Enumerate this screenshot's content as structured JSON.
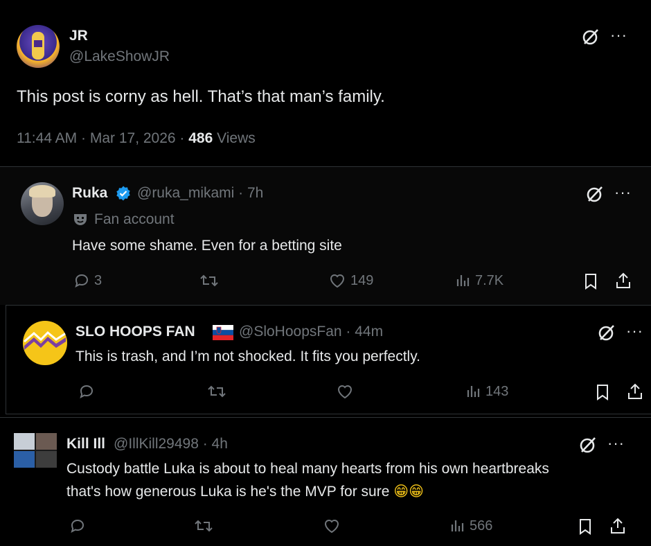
{
  "main_post": {
    "name": "JR",
    "handle": "@LakeShowJR",
    "text": "This post is corny as hell. That’s that man’s family.",
    "time": "11:44 AM · Mar 17, 2026 ·",
    "views_count": "486",
    "views_label": "Views"
  },
  "replies": [
    {
      "name": "Ruka",
      "verified": true,
      "handle_time": "@ruka_mikami · 7h",
      "badge_icon": "mask-icon",
      "badge_label": "Fan account",
      "text": "Have some shame. Even for a betting site",
      "reply_count": "3",
      "like_count": "149",
      "view_count": "7.7K"
    },
    {
      "name": "SLO HOOPS FAN",
      "flag": "slovenia-flag",
      "handle_time": "@SloHoopsFan · 44m",
      "text": "This is trash, and I’m not shocked. It fits you perfectly.",
      "view_count": "143"
    },
    {
      "name": "Kill Ill",
      "handle_time": "@IllKill29498 · 4h",
      "text_line1": "Custody battle Luka is about to heal many hearts from his own heartbreaks",
      "text_line2": "that's how generous Luka is he's the MVP for sure",
      "emoji": "😁😁",
      "view_count": "566"
    }
  ],
  "colors": {
    "background": "#000000",
    "text": "#e7e9ea",
    "muted": "#71767b",
    "divider": "#2f3336",
    "verified": "#1d9bf0"
  }
}
